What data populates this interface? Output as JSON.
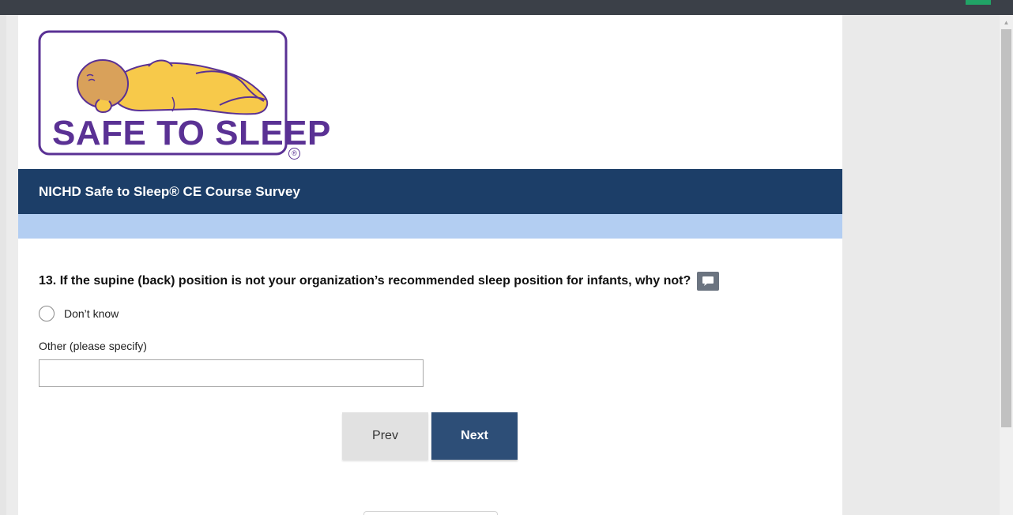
{
  "logo": {
    "text": "SAFE TO SLEEP",
    "reg_mark": "®",
    "icon": "sleeping-baby-icon"
  },
  "header": {
    "title": "NICHD Safe to Sleep® CE Course Survey"
  },
  "question": {
    "text": "13. If the supine (back) position is not your organization’s recommended sleep position for infants, why not?",
    "comment_icon": "comment-icon"
  },
  "options": [
    {
      "label": "Don’t know",
      "selected": false
    }
  ],
  "other": {
    "label": "Other  (please specify)",
    "value": "",
    "placeholder": ""
  },
  "nav": {
    "prev_label": "Prev",
    "next_label": "Next"
  },
  "colors": {
    "brand_purple": "#5a3194",
    "header_navy": "#1c3e68",
    "sub_band": "#b3cef2",
    "next_button": "#2d4e77",
    "baby_yellow": "#f7c94a"
  }
}
